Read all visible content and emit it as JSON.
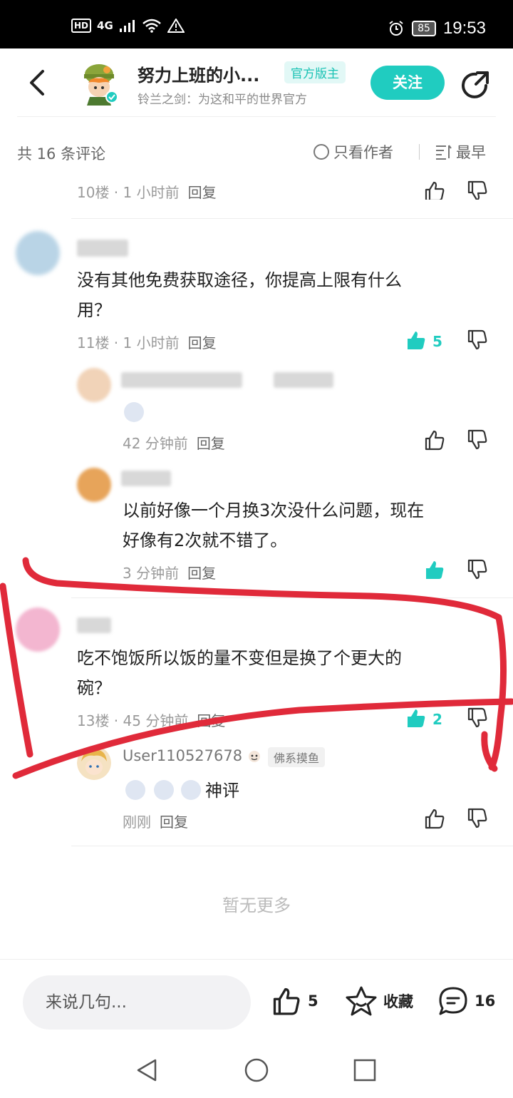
{
  "status_bar": {
    "hd": "HD",
    "network": "4G",
    "battery": "85",
    "time": "19:53"
  },
  "header": {
    "author_name": "努力上班的小...",
    "badge": "官方版主",
    "subtitle": "铃兰之剑：为这和平的世界官方",
    "follow_label": "关注"
  },
  "filter": {
    "count_label": "共 16 条评论",
    "only_author": "只看作者",
    "sort": "最早"
  },
  "comments": [
    {
      "meta": "10楼 · 1 小时前",
      "reply": "回复"
    },
    {
      "text_line1": "没有其他免费获取途径，你提高上限有什么",
      "text_line2": "用？",
      "meta": "11楼 · 1 小时前",
      "reply": "回复",
      "likes": "5",
      "replies": [
        {
          "meta": "42 分钟前",
          "reply": "回复"
        },
        {
          "text_line1": "以前好像一个月换3次没什么问题，现在",
          "text_line2": "好像有2次就不错了。",
          "meta": "3 分钟前",
          "reply": "回复"
        }
      ]
    },
    {
      "text_line1": "吃不饱饭所以饭的量不变但是换了个更大的",
      "text_line2": "碗？",
      "meta": "13楼 · 45 分钟前",
      "reply": "回复",
      "likes": "2",
      "replies": [
        {
          "user": "User110527678",
          "tag": "佛系摸鱼",
          "text": "神评",
          "meta": "刚刚",
          "reply": "回复"
        }
      ]
    }
  ],
  "no_more": "暂无更多",
  "bottom_bar": {
    "placeholder": "来说几句...",
    "likes": "5",
    "collect": "收藏",
    "comments": "16"
  },
  "colors": {
    "accent": "#20ccc0",
    "annotation": "#e02a3a"
  }
}
